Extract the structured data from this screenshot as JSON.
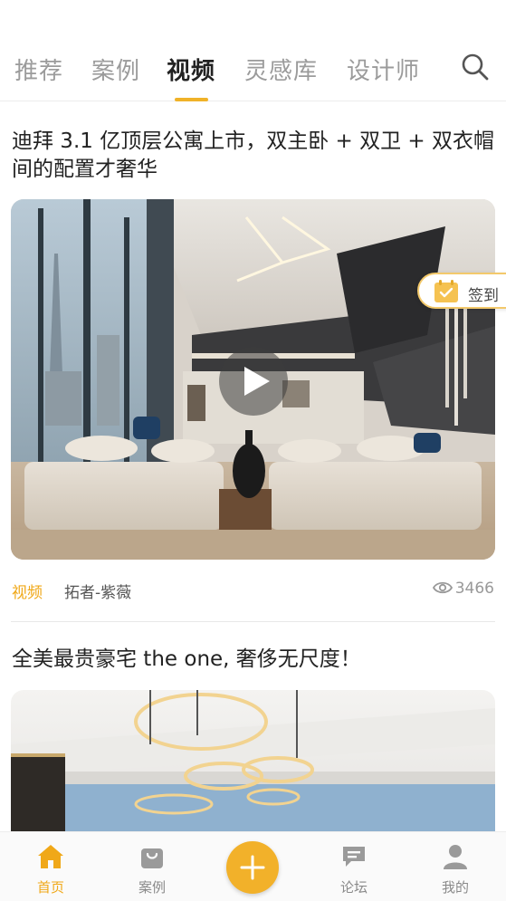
{
  "tabs": [
    {
      "label": "推荐",
      "active": false
    },
    {
      "label": "案例",
      "active": false
    },
    {
      "label": "视频",
      "active": true
    },
    {
      "label": "灵感库",
      "active": false
    },
    {
      "label": "设计师",
      "active": false
    }
  ],
  "accent_color": "#f0b228",
  "articles": [
    {
      "title": "迪拜 3.1 亿顶层公寓上市，双主卧 + 双卫 + 双衣帽间的配置才奢华",
      "type": "视频",
      "author": "拓者-紫薇",
      "views": "3466"
    },
    {
      "title": "全美最贵豪宅 the one, 奢侈无尺度！"
    }
  ],
  "signin": {
    "label": "签到"
  },
  "bottom_nav": [
    {
      "label": "首页",
      "icon": "home-icon",
      "active": true
    },
    {
      "label": "案例",
      "icon": "bag-icon",
      "active": false
    },
    {
      "label": "论坛",
      "icon": "chat-icon",
      "active": false
    },
    {
      "label": "我的",
      "icon": "user-icon",
      "active": false
    }
  ]
}
